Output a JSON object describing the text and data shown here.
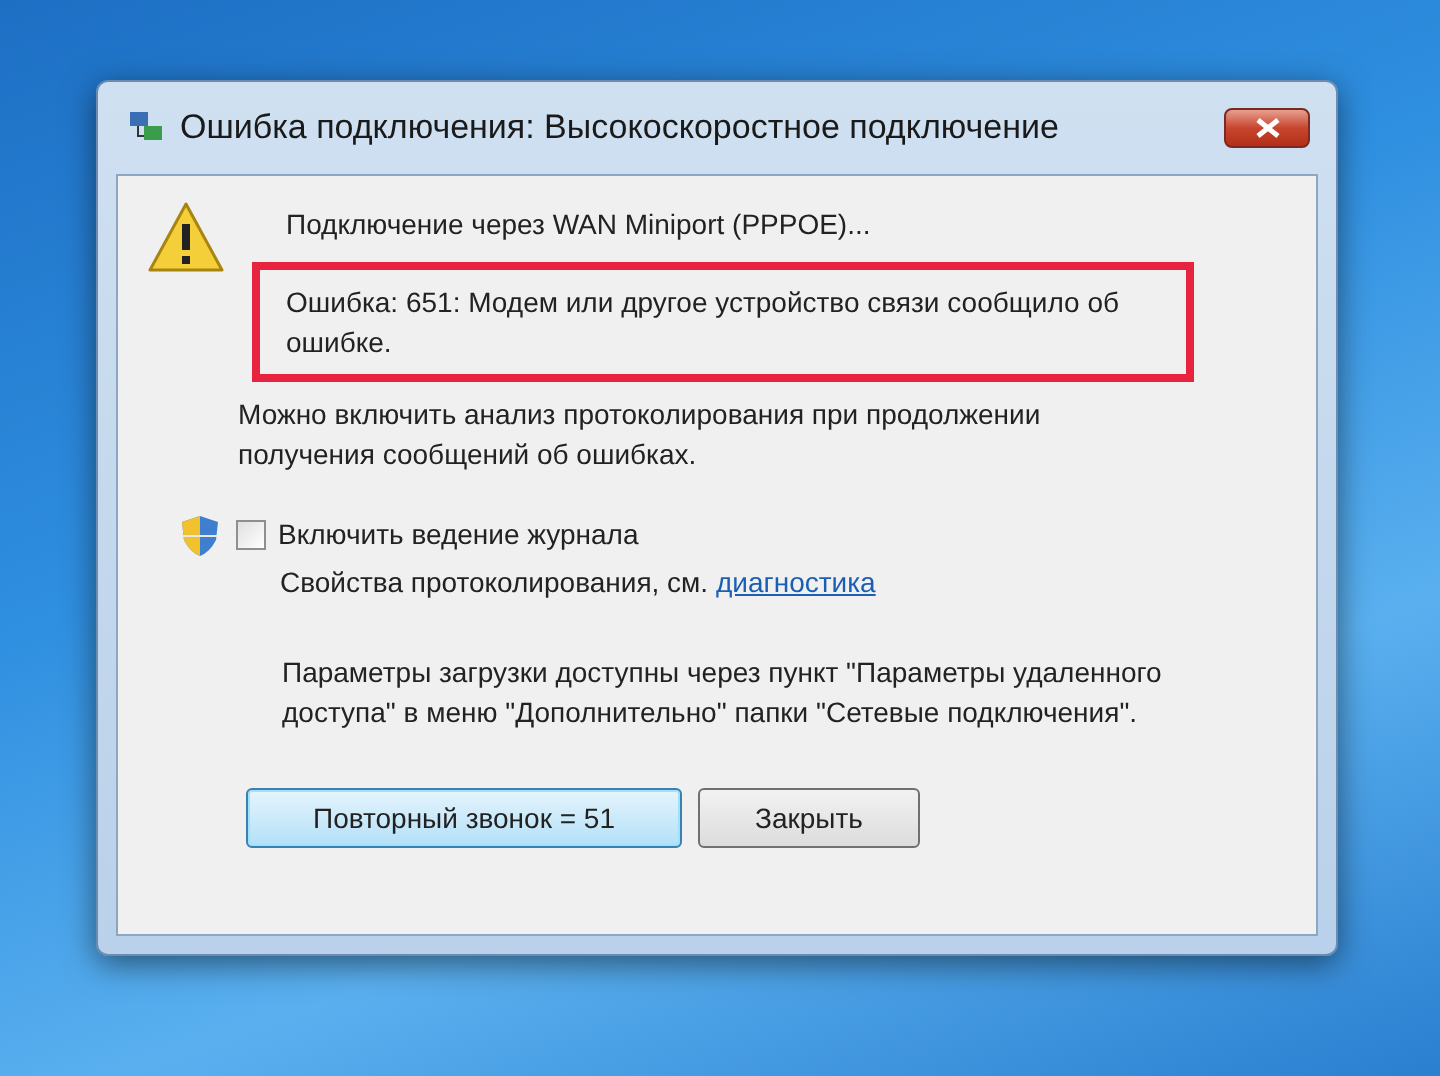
{
  "window": {
    "title": "Ошибка подключения: Высокоскоростное подключение"
  },
  "message": {
    "connecting": "Подключение через WAN Miniport (PPPOE)...",
    "error": "Ошибка: 651: Модем или другое устройство связи сообщило об ошибке.",
    "error_highlighted": true,
    "hint": "Можно включить анализ протоколирования при продолжении получения сообщений об ошибках."
  },
  "logging": {
    "checkbox_label": "Включить ведение журнала",
    "checked": false,
    "properties_text": "Свойства протоколирования, см.",
    "link": "диагностика"
  },
  "info": "Параметры загрузки доступны через пункт \"Параметры удаленного доступа\" в меню \"Дополнительно\" папки \"Сетевые подключения\".",
  "buttons": [
    {
      "label": "Повторный звонок = 51",
      "default": true
    },
    {
      "label": "Закрыть",
      "default": false
    }
  ]
}
